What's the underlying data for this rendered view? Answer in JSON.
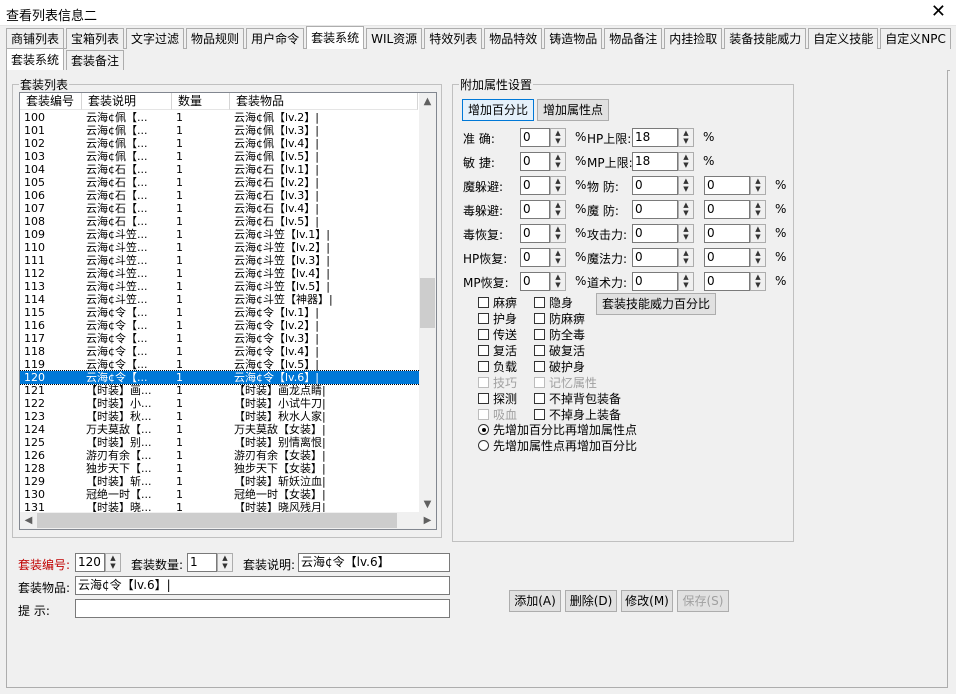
{
  "window": {
    "title": "查看列表信息二",
    "close": "✕"
  },
  "tabs_top": [
    "商铺列表",
    "宝箱列表",
    "文字过滤",
    "物品规则",
    "用户命令",
    "套装系统",
    "WIL资源",
    "特效列表",
    "物品特效",
    "铸造物品",
    "物品备注",
    "内挂捡取",
    "装备技能威力",
    "自定义技能",
    "自定义NPC"
  ],
  "tabs_sub": [
    "套装系统",
    "套装备注"
  ],
  "list": {
    "group_label": "套装列表",
    "columns": [
      "套装编号",
      "套装说明",
      "数量",
      "套装物品"
    ],
    "selected_index": 20,
    "rows": [
      [
        "100",
        "云海¢佩【...",
        "1",
        "云海¢佩【lv.2】|"
      ],
      [
        "101",
        "云海¢佩【...",
        "1",
        "云海¢佩【lv.3】|"
      ],
      [
        "102",
        "云海¢佩【...",
        "1",
        "云海¢佩【lv.4】|"
      ],
      [
        "103",
        "云海¢佩【...",
        "1",
        "云海¢佩【lv.5】|"
      ],
      [
        "104",
        "云海¢石【...",
        "1",
        "云海¢石【lv.1】|"
      ],
      [
        "105",
        "云海¢石【...",
        "1",
        "云海¢石【lv.2】|"
      ],
      [
        "106",
        "云海¢石【...",
        "1",
        "云海¢石【lv.3】|"
      ],
      [
        "107",
        "云海¢石【...",
        "1",
        "云海¢石【lv.4】|"
      ],
      [
        "108",
        "云海¢石【...",
        "1",
        "云海¢石【lv.5】|"
      ],
      [
        "109",
        "云海¢斗笠...",
        "1",
        "云海¢斗笠【lv.1】|"
      ],
      [
        "110",
        "云海¢斗笠...",
        "1",
        "云海¢斗笠【lv.2】|"
      ],
      [
        "111",
        "云海¢斗笠...",
        "1",
        "云海¢斗笠【lv.3】|"
      ],
      [
        "112",
        "云海¢斗笠...",
        "1",
        "云海¢斗笠【lv.4】|"
      ],
      [
        "113",
        "云海¢斗笠...",
        "1",
        "云海¢斗笠【lv.5】|"
      ],
      [
        "114",
        "云海¢斗笠...",
        "1",
        "云海¢斗笠【神器】|"
      ],
      [
        "115",
        "云海¢令【...",
        "1",
        "云海¢令【lv.1】|"
      ],
      [
        "116",
        "云海¢令【...",
        "1",
        "云海¢令【lv.2】|"
      ],
      [
        "117",
        "云海¢令【...",
        "1",
        "云海¢令【lv.3】|"
      ],
      [
        "118",
        "云海¢令【...",
        "1",
        "云海¢令【lv.4】|"
      ],
      [
        "119",
        "云海¢令【...",
        "1",
        "云海¢令【lv.5】|"
      ],
      [
        "120",
        "云海¢令【...",
        "1",
        "云海¢令【lv.6】|"
      ],
      [
        "121",
        "【时装】画...",
        "1",
        "【时装】画龙点睛|"
      ],
      [
        "122",
        "【时装】小...",
        "1",
        "【时装】小试牛刀|"
      ],
      [
        "123",
        "【时装】秋...",
        "1",
        "【时装】秋水人家|"
      ],
      [
        "124",
        "万夫莫敌【...",
        "1",
        "万夫莫敌【女装】|"
      ],
      [
        "125",
        "【时装】别...",
        "1",
        "【时装】别情离恨|"
      ],
      [
        "126",
        "游刃有余【...",
        "1",
        "游刃有余【女装】|"
      ],
      [
        "128",
        "独步天下【...",
        "1",
        "独步天下【女装】|"
      ],
      [
        "129",
        "【时装】斩...",
        "1",
        "【时装】斩妖泣血|"
      ],
      [
        "130",
        "冠绝一时【...",
        "1",
        "冠绝一时【女装】|"
      ],
      [
        "131",
        "【时装】晓...",
        "1",
        "【时装】晓风残月|"
      ]
    ]
  },
  "attr": {
    "group_label": "附加属性设置",
    "btn_percent": "增加百分比",
    "btn_points": "增加属性点",
    "fields": [
      {
        "label": "准  确:",
        "value": "0",
        "unit": "%"
      },
      {
        "label": "敏  捷:",
        "value": "0",
        "unit": "%"
      },
      {
        "label": "魔躲避:",
        "value": "0",
        "unit": "%"
      },
      {
        "label": "毒躲避:",
        "value": "0",
        "unit": "%"
      },
      {
        "label": "毒恢复:",
        "value": "0",
        "unit": "%"
      },
      {
        "label": "HP恢复:",
        "value": "0",
        "unit": "%"
      },
      {
        "label": "MP恢复:",
        "value": "0",
        "unit": "%"
      }
    ],
    "fields_right": [
      {
        "label": "HP上限:",
        "value": "18",
        "unit": "%"
      },
      {
        "label": "MP上限:",
        "value": "18",
        "unit": "%"
      },
      {
        "label": "物  防:",
        "value": "0",
        "value2": "0",
        "unit": "%"
      },
      {
        "label": "魔  防:",
        "value": "0",
        "value2": "0",
        "unit": "%"
      },
      {
        "label": "攻击力:",
        "value": "0",
        "value2": "0",
        "unit": "%"
      },
      {
        "label": "魔法力:",
        "value": "0",
        "value2": "0",
        "unit": "%"
      },
      {
        "label": "道术力:",
        "value": "0",
        "value2": "0",
        "unit": "%"
      }
    ],
    "checks_left": [
      "麻痹",
      "护身",
      "传送",
      "复活",
      "负载",
      "技巧",
      "探测",
      "吸血"
    ],
    "checks_right": [
      "隐身",
      "防麻痹",
      "防全毒",
      "破复活",
      "破护身",
      "记忆属性",
      "不掉背包装备",
      "不掉身上装备"
    ],
    "btn_skill": "套装技能威力百分比",
    "radio1": "先增加百分比再增加属性点",
    "radio2": "先增加属性点再增加百分比"
  },
  "form": {
    "id_label": "套装编号:",
    "id_value": "120",
    "count_label": "套装数量:",
    "count_value": "1",
    "desc_label": "套装说明:",
    "desc_value": "云海¢令【lv.6】",
    "items_label": "套装物品:",
    "items_value": "云海¢令【lv.6】|",
    "hint_label": "提  示:",
    "hint_value": "",
    "btn_add": "添加(A)",
    "btn_delete": "删除(D)",
    "btn_edit": "修改(M)",
    "btn_save": "保存(S)"
  },
  "colors": {
    "selection": "#0078d7",
    "label_red": "#c00000"
  }
}
